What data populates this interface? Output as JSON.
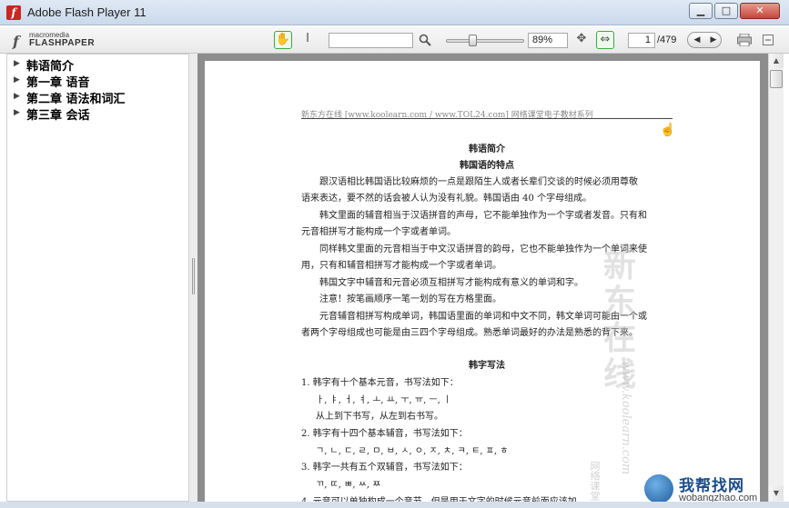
{
  "window": {
    "title": "Adobe Flash Player 11",
    "minimize_glyph": "▁",
    "maximize_glyph": "□",
    "close_glyph": "✕"
  },
  "toolbar": {
    "logo_small": "macromedia",
    "logo_big": "FLASHPAPER",
    "search_value": "",
    "zoom_value": "89%",
    "page_value": "1",
    "total_pages": "/479"
  },
  "sidebar": {
    "items": [
      {
        "label": "韩语简介"
      },
      {
        "label": "第一章 语音"
      },
      {
        "label": "第二章 语法和词汇"
      },
      {
        "label": "第三章 会话"
      }
    ]
  },
  "document": {
    "header": "新东方在线 [www.koolearn.com / www.TOL24.com] 网络课堂电子教材系列",
    "title": "韩语简介",
    "subtitle": "韩国语的特点",
    "paragraphs": [
      "跟汉语相比韩国语比较麻烦的一点是跟陌生人或者长辈们交谈的时候必须用尊敬",
      "语来表达，要不然的话会被人认为没有礼貌。韩国语由 40 个字母组成。",
      "韩文里面的辅音相当于汉语拼音的声母，它不能单独作为一个字或者发音。只有和",
      "元音相拼写才能构成一个字或者单词。",
      "同样韩文里面的元音相当于中文汉语拼音的韵母，它也不能单独作为一个单词来使",
      "用，只有和辅音相拼写才能构成一个字或者单词。",
      "韩国文字中辅音和元音必须互相拼写才能构成有意义的单词和字。",
      "注意！按笔画顺序一笔一划的写在方格里面。",
      "元音辅音相拼写构成单词，韩国语里面的单词和中文不同，韩文单词可能由一个或",
      "者两个字母组成也可能是由三四个字母组成。熟悉单词最好的办法是熟悉的背下来。"
    ],
    "section2_title": "韩字写法",
    "list_lines": [
      "1.  韩字有十个基本元音，书写法如下：",
      "ㅏ, ㅑ, ㅓ, ㅕ, ㅗ, ㅛ, ㅜ, ㅠ, ㅡ, ㅣ",
      "从上到下书写，从左到右书写。",
      "2.  韩字有十四个基本辅音，书写法如下：",
      "ㄱ, ㄴ, ㄷ, ㄹ, ㅁ, ㅂ, ㅅ, ㅇ, ㅈ, ㅊ, ㅋ, ㅌ, ㅍ, ㅎ",
      "3.  韩字一共有五个双辅音，书写法如下：",
      "ㄲ, ㄸ, ㅃ, ㅆ, ㅉ",
      "4.  元音可以单独构成一个音节，但是用于文字的时候元音前面应该加"
    ],
    "watermark_big": "新东在线",
    "watermark_url": "www.koolearn.com",
    "watermark_small": "网络课堂"
  },
  "site_badge": {
    "name": "我帮找网",
    "url": "wobangzhao.com"
  }
}
